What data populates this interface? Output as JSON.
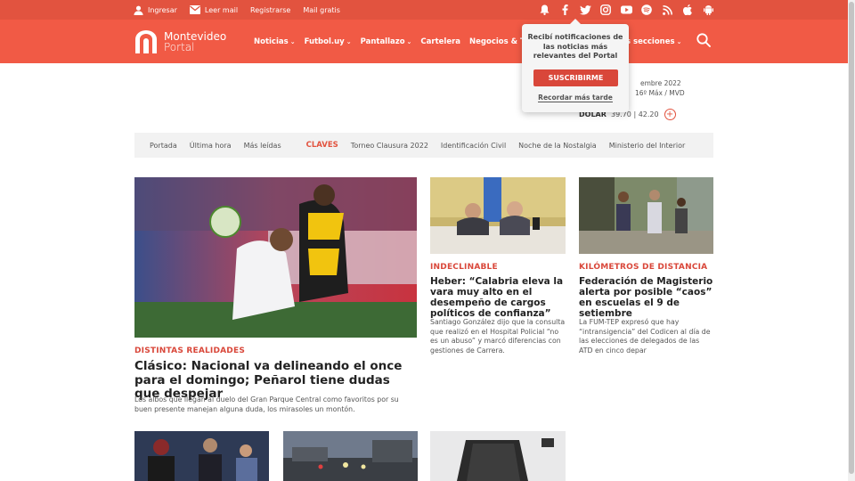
{
  "topbar": {
    "ingresar": "Ingresar",
    "leer_mail": "Leer mail",
    "registrarse": "Registrarse",
    "mail_gratis": "Mail gratis",
    "bg_color": "#e2533f"
  },
  "header": {
    "logo_line1": "Montevideo",
    "logo_line2": "Portal",
    "bg_color": "#f15a45",
    "nav": [
      {
        "label": "Noticias",
        "has_chevron": true
      },
      {
        "label": "Futbol.uy",
        "has_chevron": true
      },
      {
        "label": "Pantallazo",
        "has_chevron": true
      },
      {
        "label": "Cartelera",
        "has_chevron": false
      },
      {
        "label": "Negocios & Tendencias",
        "has_chevron": false
      }
    ],
    "nav_more": "s secciones"
  },
  "popup": {
    "message": "Recibí notificaciones de las noticias más relevantes del Portal",
    "subscribe": "SUSCRIBIRME",
    "later": "Recordar más tarde"
  },
  "weather": {
    "date": "embre 2022",
    "temp": "16º Máx / MVD"
  },
  "dolar": {
    "label": "DÓLAR",
    "buy": "39.70",
    "separator": "|",
    "sell": "42.20"
  },
  "subnav": {
    "items": [
      "Portada",
      "Última hora",
      "Más leídas"
    ],
    "claves_label": "CLAVES",
    "claves": [
      "Torneo Clausura 2022",
      "Identificación Civil",
      "Noche de la Nostalgia",
      "Ministerio del Interior"
    ]
  },
  "articles": {
    "main": {
      "kicker": "DISTINTAS REALIDADES",
      "headline": "Clásico: Nacional va delineando el once para el domingo; Peñarol tiene dudas que despejar",
      "summary": "Los albos que llegan al duelo del Gran Parque Central como favoritos por su buen presente manejan alguna duda, los mirasoles un montón."
    },
    "second": {
      "kicker": "INDECLINABLE",
      "headline": "Heber: “Calabria eleva la vara muy alto en el desempeño de cargos políticos de confianza”",
      "summary": "Santiago González dijo que la consulta que realizó en el Hospital Policial “no es un abuso” y marcó diferencias con gestiones de Carrera."
    },
    "third": {
      "kicker": "KILÓMETROS DE DISTANCIA",
      "headline": "Federación de Magisterio alerta por posible “caos” en escuelas el 9 de setiembre",
      "summary": "La FUM-TEP expresó que hay “intransigencia” del Codicen al día de las elecciones de delegados de las ATD en cinco depar"
    }
  },
  "colors": {
    "accent": "#d9473a",
    "subnav_bg": "#f2f2f2"
  }
}
